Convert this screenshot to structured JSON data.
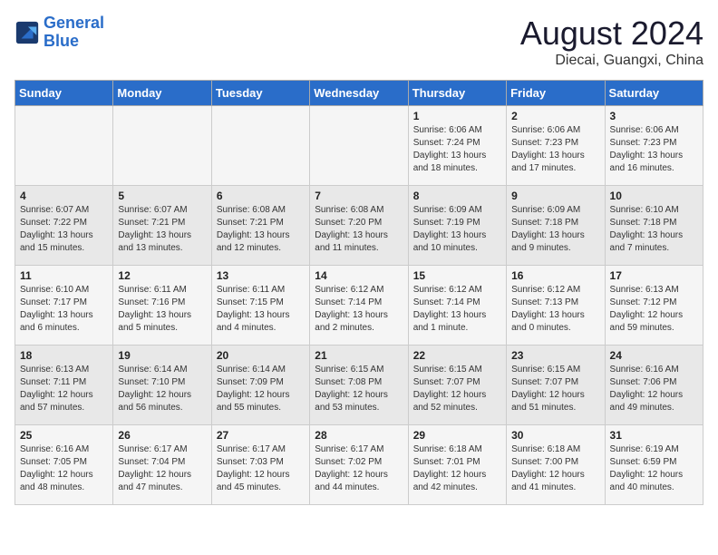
{
  "logo": {
    "line1": "General",
    "line2": "Blue"
  },
  "title": "August 2024",
  "subtitle": "Diecai, Guangxi, China",
  "days_of_week": [
    "Sunday",
    "Monday",
    "Tuesday",
    "Wednesday",
    "Thursday",
    "Friday",
    "Saturday"
  ],
  "weeks": [
    [
      {
        "day": "",
        "content": ""
      },
      {
        "day": "",
        "content": ""
      },
      {
        "day": "",
        "content": ""
      },
      {
        "day": "",
        "content": ""
      },
      {
        "day": "1",
        "content": "Sunrise: 6:06 AM\nSunset: 7:24 PM\nDaylight: 13 hours and 18 minutes."
      },
      {
        "day": "2",
        "content": "Sunrise: 6:06 AM\nSunset: 7:23 PM\nDaylight: 13 hours and 17 minutes."
      },
      {
        "day": "3",
        "content": "Sunrise: 6:06 AM\nSunset: 7:23 PM\nDaylight: 13 hours and 16 minutes."
      }
    ],
    [
      {
        "day": "4",
        "content": "Sunrise: 6:07 AM\nSunset: 7:22 PM\nDaylight: 13 hours and 15 minutes."
      },
      {
        "day": "5",
        "content": "Sunrise: 6:07 AM\nSunset: 7:21 PM\nDaylight: 13 hours and 13 minutes."
      },
      {
        "day": "6",
        "content": "Sunrise: 6:08 AM\nSunset: 7:21 PM\nDaylight: 13 hours and 12 minutes."
      },
      {
        "day": "7",
        "content": "Sunrise: 6:08 AM\nSunset: 7:20 PM\nDaylight: 13 hours and 11 minutes."
      },
      {
        "day": "8",
        "content": "Sunrise: 6:09 AM\nSunset: 7:19 PM\nDaylight: 13 hours and 10 minutes."
      },
      {
        "day": "9",
        "content": "Sunrise: 6:09 AM\nSunset: 7:18 PM\nDaylight: 13 hours and 9 minutes."
      },
      {
        "day": "10",
        "content": "Sunrise: 6:10 AM\nSunset: 7:18 PM\nDaylight: 13 hours and 7 minutes."
      }
    ],
    [
      {
        "day": "11",
        "content": "Sunrise: 6:10 AM\nSunset: 7:17 PM\nDaylight: 13 hours and 6 minutes."
      },
      {
        "day": "12",
        "content": "Sunrise: 6:11 AM\nSunset: 7:16 PM\nDaylight: 13 hours and 5 minutes."
      },
      {
        "day": "13",
        "content": "Sunrise: 6:11 AM\nSunset: 7:15 PM\nDaylight: 13 hours and 4 minutes."
      },
      {
        "day": "14",
        "content": "Sunrise: 6:12 AM\nSunset: 7:14 PM\nDaylight: 13 hours and 2 minutes."
      },
      {
        "day": "15",
        "content": "Sunrise: 6:12 AM\nSunset: 7:14 PM\nDaylight: 13 hours and 1 minute."
      },
      {
        "day": "16",
        "content": "Sunrise: 6:12 AM\nSunset: 7:13 PM\nDaylight: 13 hours and 0 minutes."
      },
      {
        "day": "17",
        "content": "Sunrise: 6:13 AM\nSunset: 7:12 PM\nDaylight: 12 hours and 59 minutes."
      }
    ],
    [
      {
        "day": "18",
        "content": "Sunrise: 6:13 AM\nSunset: 7:11 PM\nDaylight: 12 hours and 57 minutes."
      },
      {
        "day": "19",
        "content": "Sunrise: 6:14 AM\nSunset: 7:10 PM\nDaylight: 12 hours and 56 minutes."
      },
      {
        "day": "20",
        "content": "Sunrise: 6:14 AM\nSunset: 7:09 PM\nDaylight: 12 hours and 55 minutes."
      },
      {
        "day": "21",
        "content": "Sunrise: 6:15 AM\nSunset: 7:08 PM\nDaylight: 12 hours and 53 minutes."
      },
      {
        "day": "22",
        "content": "Sunrise: 6:15 AM\nSunset: 7:07 PM\nDaylight: 12 hours and 52 minutes."
      },
      {
        "day": "23",
        "content": "Sunrise: 6:15 AM\nSunset: 7:07 PM\nDaylight: 12 hours and 51 minutes."
      },
      {
        "day": "24",
        "content": "Sunrise: 6:16 AM\nSunset: 7:06 PM\nDaylight: 12 hours and 49 minutes."
      }
    ],
    [
      {
        "day": "25",
        "content": "Sunrise: 6:16 AM\nSunset: 7:05 PM\nDaylight: 12 hours and 48 minutes."
      },
      {
        "day": "26",
        "content": "Sunrise: 6:17 AM\nSunset: 7:04 PM\nDaylight: 12 hours and 47 minutes."
      },
      {
        "day": "27",
        "content": "Sunrise: 6:17 AM\nSunset: 7:03 PM\nDaylight: 12 hours and 45 minutes."
      },
      {
        "day": "28",
        "content": "Sunrise: 6:17 AM\nSunset: 7:02 PM\nDaylight: 12 hours and 44 minutes."
      },
      {
        "day": "29",
        "content": "Sunrise: 6:18 AM\nSunset: 7:01 PM\nDaylight: 12 hours and 42 minutes."
      },
      {
        "day": "30",
        "content": "Sunrise: 6:18 AM\nSunset: 7:00 PM\nDaylight: 12 hours and 41 minutes."
      },
      {
        "day": "31",
        "content": "Sunrise: 6:19 AM\nSunset: 6:59 PM\nDaylight: 12 hours and 40 minutes."
      }
    ]
  ]
}
